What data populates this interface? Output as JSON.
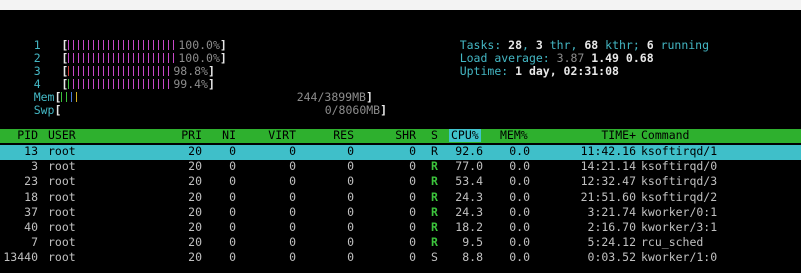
{
  "meters": {
    "cpus": [
      {
        "label": "1",
        "percent": "100.0%",
        "ticks": [
          {
            "c": "#c848c8",
            "n": 22
          }
        ]
      },
      {
        "label": "2",
        "percent": "100.0%",
        "ticks": [
          {
            "c": "#c848c8",
            "n": 22
          }
        ]
      },
      {
        "label": "3",
        "percent": "98.8%",
        "ticks": [
          {
            "c": "#d03c3c",
            "n": 1
          },
          {
            "c": "#c848c8",
            "n": 20
          }
        ]
      },
      {
        "label": "4",
        "percent": "99.4%",
        "ticks": [
          {
            "c": "#3cc43c",
            "n": 1
          },
          {
            "c": "#c848c8",
            "n": 20
          }
        ]
      }
    ],
    "mem": {
      "label": "Mem",
      "value": "244/3899MB",
      "ticks": [
        "#3cc43c",
        "#3cc43c",
        "#4a7cd8",
        "#d4b020"
      ]
    },
    "swp": {
      "label": "Swp",
      "value": "0/8060MB"
    }
  },
  "summary": {
    "tasks_label": "Tasks: ",
    "tasks": "28",
    "thr_sep": ", ",
    "thr": "3",
    "thr_label": " thr, ",
    "kthr": "68",
    "kthr_label": " kthr; ",
    "running": "6",
    "running_label": " running",
    "load_label": "Load average: ",
    "load1": "3.87",
    "load5": "1.49",
    "load15": "0.68",
    "uptime_label": "Uptime: ",
    "uptime": "1 day, 02:31:08"
  },
  "columns": [
    "PID",
    "USER",
    "PRI",
    "NI",
    "VIRT",
    "RES",
    "SHR",
    "S",
    "CPU%",
    "MEM%",
    "TIME+",
    "Command"
  ],
  "processes": [
    {
      "pid": "13",
      "user": "root",
      "pri": "20",
      "ni": "0",
      "virt": "0",
      "res": "0",
      "shr": "0",
      "s": "R",
      "cpu": "92.6",
      "mem": "0.0",
      "time": "11:42.16",
      "cmd": "ksoftirqd/1",
      "selected": true
    },
    {
      "pid": "3",
      "user": "root",
      "pri": "20",
      "ni": "0",
      "virt": "0",
      "res": "0",
      "shr": "0",
      "s": "R",
      "cpu": "77.0",
      "mem": "0.0",
      "time": "14:21.14",
      "cmd": "ksoftirqd/0"
    },
    {
      "pid": "23",
      "user": "root",
      "pri": "20",
      "ni": "0",
      "virt": "0",
      "res": "0",
      "shr": "0",
      "s": "R",
      "cpu": "53.4",
      "mem": "0.0",
      "time": "12:32.47",
      "cmd": "ksoftirqd/3"
    },
    {
      "pid": "18",
      "user": "root",
      "pri": "20",
      "ni": "0",
      "virt": "0",
      "res": "0",
      "shr": "0",
      "s": "R",
      "cpu": "24.3",
      "mem": "0.0",
      "time": "21:51.60",
      "cmd": "ksoftirqd/2"
    },
    {
      "pid": "37",
      "user": "root",
      "pri": "20",
      "ni": "0",
      "virt": "0",
      "res": "0",
      "shr": "0",
      "s": "R",
      "cpu": "24.3",
      "mem": "0.0",
      "time": "3:21.74",
      "cmd": "kworker/0:1"
    },
    {
      "pid": "40",
      "user": "root",
      "pri": "20",
      "ni": "0",
      "virt": "0",
      "res": "0",
      "shr": "0",
      "s": "R",
      "cpu": "18.2",
      "mem": "0.0",
      "time": "2:16.70",
      "cmd": "kworker/3:1"
    },
    {
      "pid": "7",
      "user": "root",
      "pri": "20",
      "ni": "0",
      "virt": "0",
      "res": "0",
      "shr": "0",
      "s": "R",
      "cpu": "9.5",
      "mem": "0.0",
      "time": "5:24.12",
      "cmd": "rcu_sched"
    },
    {
      "pid": "13440",
      "user": "root",
      "pri": "20",
      "ni": "0",
      "virt": "0",
      "res": "0",
      "shr": "0",
      "s": "S",
      "cpu": "8.8",
      "mem": "0.0",
      "time": "0:03.52",
      "cmd": "kworker/1:0"
    }
  ]
}
